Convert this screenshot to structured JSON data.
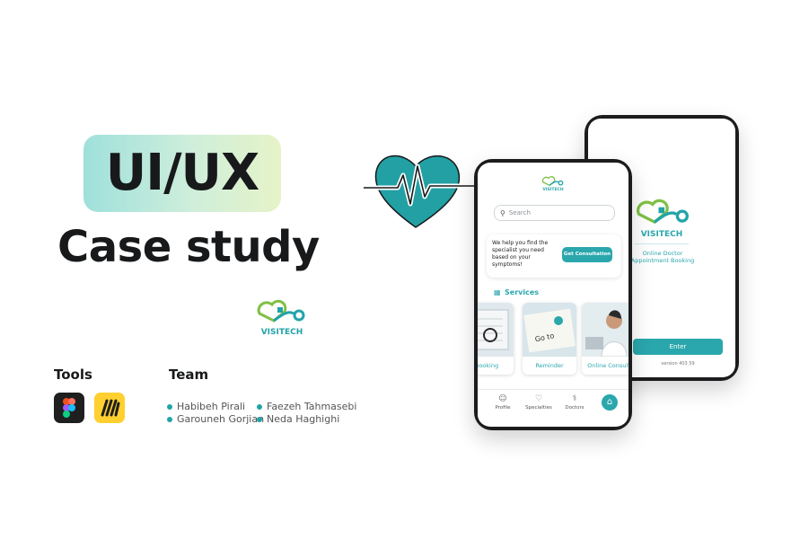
{
  "hero": {
    "badge": "UI/UX",
    "subtitle": "Case study"
  },
  "brand": {
    "name": "VISITECH"
  },
  "tools": {
    "heading": "Tools",
    "items": [
      "figma-icon",
      "miro-icon"
    ]
  },
  "team": {
    "heading": "Team",
    "members": [
      "Habibeh Pirali",
      "Faezeh Tahmasebi",
      "Garouneh Gorjian",
      "Neda Haghighi"
    ]
  },
  "home_screen": {
    "brand": "VISITECH",
    "search_placeholder": "Search",
    "help_text": "We help you find the specialist you need based on your symptoms!",
    "consult_label": "Get Consultation",
    "services_title": "Services",
    "services": [
      "Booking",
      "Reminder",
      "Online Consult"
    ],
    "nav": [
      "Profile",
      "Specialties",
      "Doctors"
    ]
  },
  "splash_screen": {
    "brand": "VISITECH",
    "tagline": "Online Doctor Appointment Booking",
    "enter_label": "Enter",
    "version": "version 403.59"
  },
  "colors": {
    "accent": "#2aa7ad",
    "brand_green": "#7fc045",
    "text_dark": "#17191b"
  }
}
